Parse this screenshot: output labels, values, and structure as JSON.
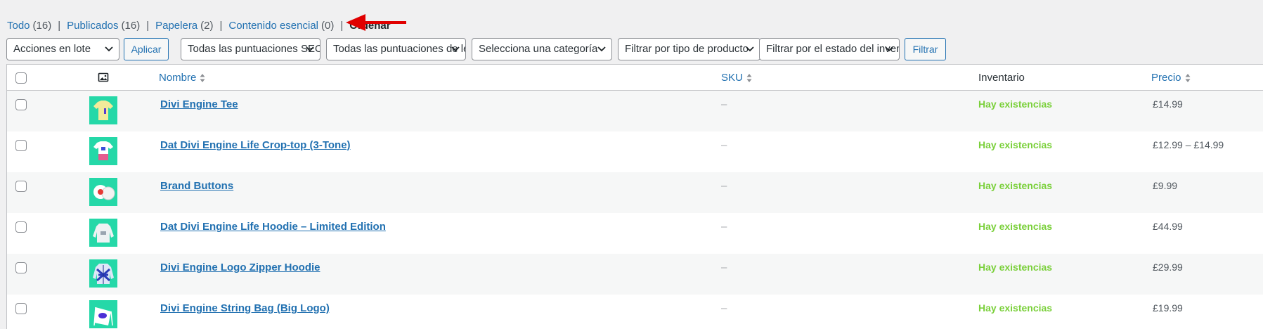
{
  "views": [
    {
      "label": "Todo",
      "count": "(16)"
    },
    {
      "label": "Publicados",
      "count": "(16)"
    },
    {
      "label": "Papelera",
      "count": "(2)"
    },
    {
      "label": "Contenido esencial",
      "count": "(0)"
    }
  ],
  "current_view": "Ordenar",
  "filters": {
    "bulk_actions": "Acciones en lote",
    "apply": "Aplicar",
    "ratings_1": "Todas las puntuaciones SEO",
    "ratings_2": "Todas las puntuaciones de legibilidad",
    "category": "Selecciona una categoría",
    "product_type": "Filtrar por tipo de producto",
    "stock_status": "Filtrar por el estado del inventario",
    "filter": "Filtrar"
  },
  "columns": {
    "name": "Nombre",
    "sku": "SKU",
    "stock": "Inventario",
    "price": "Precio"
  },
  "products": [
    {
      "name": "Divi Engine Tee",
      "sku": "–",
      "stock": "Hay existencias",
      "price": "£14.99",
      "thumb": "tshirt-icon"
    },
    {
      "name": "Dat Divi Engine Life Crop-top (3-Tone)",
      "sku": "–",
      "stock": "Hay existencias",
      "price": "£12.99 – £14.99",
      "thumb": "croptop-icon"
    },
    {
      "name": "Brand Buttons",
      "sku": "–",
      "stock": "Hay existencias",
      "price": "£9.99",
      "thumb": "buttons-icon"
    },
    {
      "name": "Dat Divi Engine Life Hoodie – Limited Edition",
      "sku": "–",
      "stock": "Hay existencias",
      "price": "£44.99",
      "thumb": "hoodie-icon"
    },
    {
      "name": "Divi Engine Logo Zipper Hoodie",
      "sku": "–",
      "stock": "Hay existencias",
      "price": "£29.99",
      "thumb": "zipper-hoodie-icon"
    },
    {
      "name": "Divi Engine String Bag (Big Logo)",
      "sku": "–",
      "stock": "Hay existencias",
      "price": "£19.99",
      "thumb": "string-bag-icon"
    }
  ],
  "colors": {
    "link": "#2271b1",
    "in_stock": "#7ad03a",
    "annotation_arrow": "#e00000",
    "thumb_bg": "#25d8a8"
  }
}
